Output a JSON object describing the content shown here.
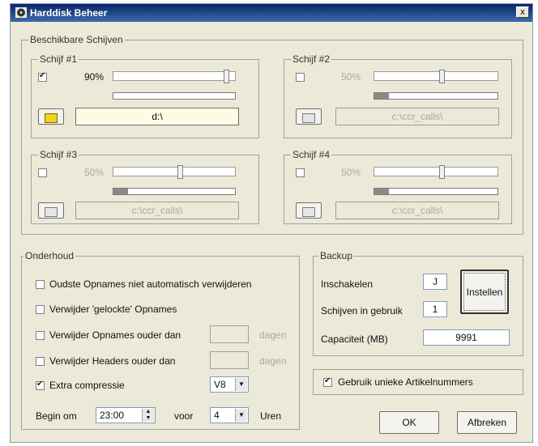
{
  "window": {
    "title": "Harddisk Beheer",
    "close_label": "x"
  },
  "drives_group": {
    "title": "Beschikbare Schijven",
    "drives": [
      {
        "label": "Schijf #1",
        "enabled": true,
        "checked": true,
        "percent": "90%",
        "slider_value": 0.95,
        "usage_fill": 0.0,
        "path": "d:\\"
      },
      {
        "label": "Schijf #2",
        "enabled": false,
        "checked": false,
        "percent": "50%",
        "slider_value": 0.55,
        "usage_fill": 0.12,
        "path": "c:\\ccr_calls\\"
      },
      {
        "label": "Schijf #3",
        "enabled": false,
        "checked": false,
        "percent": "50%",
        "slider_value": 0.55,
        "usage_fill": 0.12,
        "path": "c:\\ccr_calls\\"
      },
      {
        "label": "Schijf #4",
        "enabled": false,
        "checked": false,
        "percent": "50%",
        "slider_value": 0.55,
        "usage_fill": 0.12,
        "path": "c:\\ccr_calls\\"
      }
    ]
  },
  "maintenance": {
    "title": "Onderhoud",
    "oldest_label": "Oudste Opnames niet automatisch verwijderen",
    "locked_label": "Verwijder 'gelockte' Opnames",
    "older_rec_label": "Verwijder Opnames ouder dan",
    "older_hdr_label": "Verwijder Headers ouder dan",
    "days_unit_1": "dagen",
    "days_unit_2": "dagen",
    "compress_label": "Extra compressie",
    "compress_value": "V8",
    "begin_label": "Begin om",
    "begin_time": "23:00",
    "for_label": "voor",
    "hours_value": "4",
    "hours_unit": "Uren"
  },
  "backup": {
    "title": "Backup",
    "enable_label": "Inschakelen",
    "enable_value": "J",
    "drives_label": "Schijven in gebruik",
    "drives_value": "1",
    "capacity_label": "Capaciteit (MB)",
    "capacity_value": "9991",
    "settings_button": "Instellen"
  },
  "unique_articles_label": "Gebruik unieke Artikelnummers",
  "ok_button": "OK",
  "cancel_button": "Afbreken"
}
